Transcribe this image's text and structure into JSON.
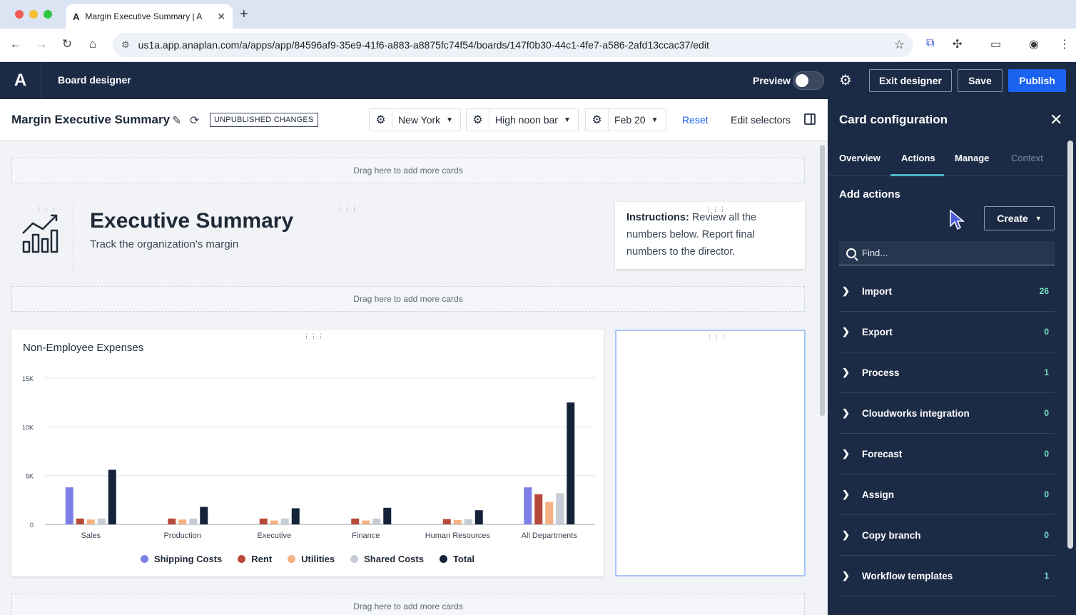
{
  "browser": {
    "tab_title": "Margin Executive Summary | A",
    "tab_logo": "A",
    "url": "us1a.app.anaplan.com/a/apps/app/84596af9-35e9-41f6-a883-a8875fc74f54/boards/147f0b30-44c1-4fe7-a586-2afd13ccac37/edit"
  },
  "header": {
    "logo": "A",
    "title": "Board designer",
    "preview_label": "Preview",
    "exit_label": "Exit designer",
    "save_label": "Save",
    "publish_label": "Publish"
  },
  "toolbar": {
    "board_title": "Margin Executive Summary",
    "badge": "UNPUBLISHED CHANGES",
    "selectors": [
      "New York",
      "High noon bar",
      "Feb 20"
    ],
    "reset": "Reset",
    "edit_selectors": "Edit selectors"
  },
  "canvas": {
    "drop_text": "Drag here to add more cards",
    "exec_title": "Executive Summary",
    "exec_subtitle": "Track the organization's margin",
    "instructions_bold": "Instructions:",
    "instructions_text": " Review all the numbers below. Report final numbers to the director."
  },
  "chart_data": {
    "type": "bar",
    "title": "Non-Employee Expenses",
    "categories": [
      "Sales",
      "Production",
      "Executive",
      "Finance",
      "Human Resources",
      "All Departments"
    ],
    "yticks": [
      "0",
      "5K",
      "10K",
      "15K"
    ],
    "ylim": [
      0,
      15000
    ],
    "grid": true,
    "legend_position": "bottom",
    "series": [
      {
        "name": "Shipping Costs",
        "color": "#7f7fe8",
        "values": [
          3800,
          0,
          0,
          0,
          0,
          3800
        ]
      },
      {
        "name": "Rent",
        "color": "#b8483a",
        "values": [
          600,
          600,
          600,
          600,
          550,
          3100
        ]
      },
      {
        "name": "Utilities",
        "color": "#f5b184",
        "values": [
          500,
          500,
          400,
          400,
          450,
          2300
        ]
      },
      {
        "name": "Shared Costs",
        "color": "#c6ccd6",
        "values": [
          600,
          600,
          600,
          600,
          550,
          3200
        ]
      },
      {
        "name": "Total",
        "color": "#15233a",
        "values": [
          5600,
          1800,
          1650,
          1700,
          1450,
          12500
        ]
      }
    ]
  },
  "config_panel": {
    "title": "Card configuration",
    "tabs": [
      "Overview",
      "Actions",
      "Manage",
      "Context"
    ],
    "section": "Add actions",
    "create_label": "Create",
    "find_placeholder": "Find...",
    "actions": [
      {
        "label": "Import",
        "count": "26"
      },
      {
        "label": "Export",
        "count": "0"
      },
      {
        "label": "Process",
        "count": "1"
      },
      {
        "label": "Cloudworks integration",
        "count": "0"
      },
      {
        "label": "Forecast",
        "count": "0"
      },
      {
        "label": "Assign",
        "count": "0"
      },
      {
        "label": "Copy branch",
        "count": "0"
      },
      {
        "label": "Workflow templates",
        "count": "1"
      }
    ]
  }
}
